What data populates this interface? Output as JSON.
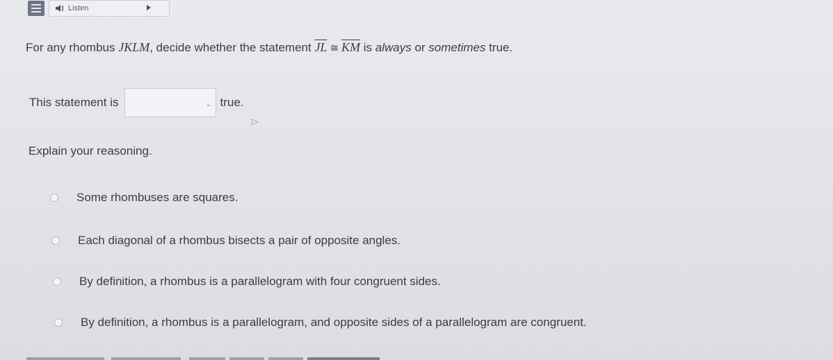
{
  "toolbar": {
    "menu_icon": "menu-icon",
    "listen_label": "Listen",
    "speaker_icon": "speaker-icon",
    "play_icon": "play-icon"
  },
  "question": {
    "prefix": "For any rhombus ",
    "shape_name": "JKLM",
    "middle": ", decide whether the statement ",
    "segment_a": "JL",
    "congruent_symbol": "≅",
    "segment_b": "KM",
    "suffix_1": " is ",
    "always": "always",
    "or": " or ",
    "sometimes": "sometimes",
    "suffix_2": " true."
  },
  "statement": {
    "prefix": "This statement is",
    "selected_value": "",
    "suffix": "true."
  },
  "explain_label": "Explain your reasoning.",
  "options": [
    {
      "label": "Some rhombuses are squares."
    },
    {
      "label": "Each diagonal of a rhombus bisects a pair of opposite angles."
    },
    {
      "label": "By definition, a rhombus is a parallelogram with four congruent sides."
    },
    {
      "label": "By definition, a rhombus is a parallelogram, and opposite sides of a parallelogram are congruent."
    }
  ],
  "colors": {
    "background": "#e4e5e9",
    "text": "#3a3d44",
    "menu_button": "#6e7585"
  }
}
